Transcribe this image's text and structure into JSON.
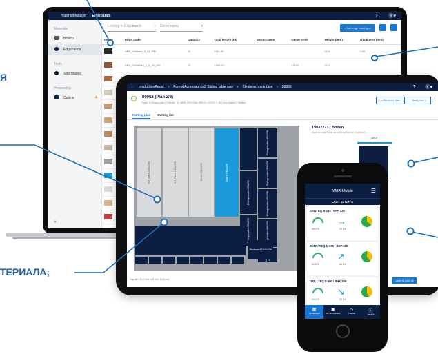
{
  "side_text": [
    "Я",
    "ТЕРИАЛА;"
  ],
  "laptop": {
    "app_title": "materialManager",
    "crumb": "Edgebands",
    "sidebar": {
      "sections": [
        {
          "label": "Materials",
          "items": [
            {
              "label": "Boards",
              "icon": "board-icon"
            },
            {
              "label": "Edgebands",
              "icon": "edgeband-icon",
              "selected": true
            }
          ]
        },
        {
          "label": "Tools",
          "items": [
            {
              "label": "Saw blades",
              "icon": "sawblade-icon"
            }
          ]
        },
        {
          "label": "Processing",
          "items": [
            {
              "label": "Cutting",
              "icon": "cutting-icon",
              "warning": true
            }
          ]
        }
      ]
    },
    "search_placeholder": "Looking in Edgebands",
    "decor_placeholder": "Decor name",
    "add_label": "+ Add edge band type",
    "columns": [
      "Image",
      "Edge code",
      "Quantity",
      "Total length (m)",
      "Decor name",
      "Decor code",
      "Height (mm)",
      "Thickness (mm)"
    ],
    "rows": [
      {
        "color": "#2b2b2b",
        "code": "ABS_Schwarz_2_42_PM",
        "qty": "10",
        "len": "1145,00",
        "dname": "",
        "dcode": "",
        "h": "42,0",
        "t": "2,00"
      },
      {
        "color": "#8b5a3c",
        "code": "ABS_Eiche hell_1_5_42_HM",
        "qty": "10",
        "len": "1380,00",
        "dname": "",
        "dcode": "43130",
        "h": "42,0",
        "t": "",
        "h2": ""
      },
      {
        "color": "#a66a3f"
      },
      {
        "color": "#d8c9b6"
      },
      {
        "color": "#c69a6e"
      },
      {
        "color": "#cfa779"
      },
      {
        "color": "#b9895f"
      },
      {
        "color": "#c9b8a2"
      },
      {
        "color": "#9c9fa3"
      },
      {
        "color": "#1a9ad8"
      },
      {
        "color": "#dcdcdc"
      },
      {
        "color": "#d8b58a"
      },
      {
        "color": "#c94040"
      }
    ]
  },
  "tablet": {
    "breadcrumb": [
      "productionAssist",
      "FormatAnmessungs2 Sliding table saw",
      "Kleiderschrank Lisa",
      "88888"
    ],
    "plan_title": "00062 (Plan 2/3)",
    "plan_meta": "Parts 12   Board code 12 Weiss, 16, 2800, 2070   Size 2800,0 x 2070,0 x 16,0 mm   Status 3 Started",
    "nav": [
      "< Previous plan",
      "Next plan >"
    ],
    "tabs": [
      "Cutting plan",
      "Cutting list"
    ],
    "pieces": [
      {
        "label": "KB_unten 1664x396",
        "style": "grey"
      },
      {
        "label": "KB_Oben 1664x396",
        "style": "grey"
      },
      {
        "label": "Deckel 1664x396",
        "style": "grey"
      },
      {
        "label": "Boden 1664x396",
        "style": "blue"
      },
      {
        "label": "",
        "style": "navy"
      },
      {
        "label": "Einlegeboden 396x296",
        "style": "navy"
      },
      {
        "label": "Einlegeboden 396x296",
        "style": "navy"
      },
      {
        "label": "Einlegeboden 396x296",
        "style": "navy"
      },
      {
        "label": "Einlegeboden 396x296",
        "style": "navy"
      },
      {
        "label": "Einlegeboden 396x296",
        "style": "navy"
      },
      {
        "label": "Einlegeboden 396x296",
        "style": "navy"
      },
      {
        "label": "Linke Seite 1200x326",
        "style": "navy"
      },
      {
        "label": "",
        "style": "navy"
      },
      {
        "label": "Rückwand 1044x100",
        "style": "navy"
      }
    ],
    "part_title": "19032273 | Boden",
    "part_meta": "Wdw 35    Order Kleiderschrank Lisa    Number of parts 1/1",
    "dimension": "429,5",
    "footer": "Top trim: 10,0 mm   Left trim: 10,0 mm",
    "cta": "Label & print all"
  },
  "phone": {
    "title": "MMR Mobile",
    "period": "LAST 14 DAYS",
    "machines": [
      {
        "name": "SAWTEQ B-130 / HPP 130",
        "gauge": "65.9 %",
        "arrow": "→",
        "trend": "24.5/h",
        "pie_green": 35
      },
      {
        "name": "CENTATEQ N-600 / BHP 200",
        "gauge": "62.5 %",
        "arrow": "↗",
        "trend": "66.6/h",
        "pie_green": 40
      },
      {
        "name": "DRILLTEQ V-600 / BHX 200",
        "gauge": "44.9 %",
        "arrow": "↘",
        "trend": "30.5/h",
        "pie_green": 45
      }
    ],
    "tabs": [
      {
        "label": "OVERVIEW",
        "icon": "grid-icon"
      },
      {
        "label": "MY MACHINES",
        "icon": "machine-icon"
      },
      {
        "label": "TREND",
        "icon": "trend-icon"
      },
      {
        "label": "ABOUT",
        "icon": "info-icon"
      }
    ]
  },
  "colors": {
    "navy": "#0c1e42",
    "accent": "#1976d2",
    "cyan": "#1a9ad8",
    "callout": "#1b6fb8",
    "warning": "#f5a623"
  }
}
